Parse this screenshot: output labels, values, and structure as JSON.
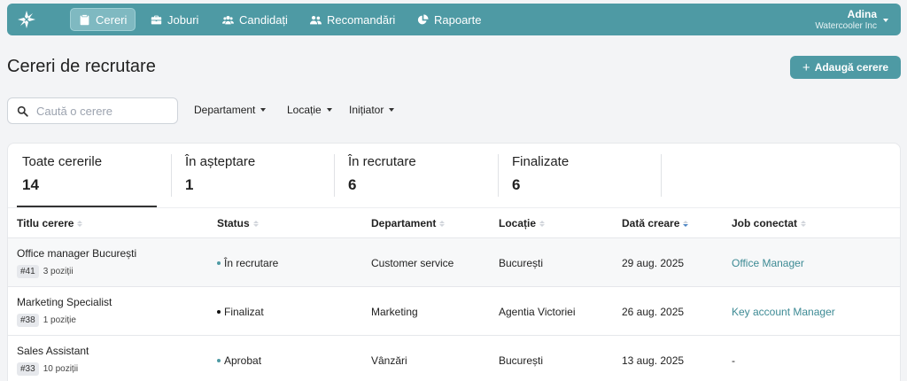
{
  "nav": {
    "items": [
      {
        "label": "Cereri",
        "icon": "clipboard-icon",
        "active": true
      },
      {
        "label": "Joburi",
        "icon": "briefcase-icon"
      },
      {
        "label": "Candidați",
        "icon": "users-icon"
      },
      {
        "label": "Recomandări",
        "icon": "user-pair-icon"
      },
      {
        "label": "Rapoarte",
        "icon": "pie-chart-icon"
      }
    ],
    "user": {
      "name": "Adina",
      "org": "Watercooler Inc"
    }
  },
  "page": {
    "title": "Cereri de recrutare",
    "add_label": "Adaugă cerere"
  },
  "search": {
    "placeholder": "Caută o cerere",
    "value": ""
  },
  "filters": [
    "Departament",
    "Locație",
    "Inițiator"
  ],
  "stats": [
    {
      "label": "Toate cererile",
      "count": "14"
    },
    {
      "label": "În așteptare",
      "count": "1"
    },
    {
      "label": "În recrutare",
      "count": "6"
    },
    {
      "label": "Finalizate",
      "count": "6"
    }
  ],
  "table": {
    "columns": [
      "Titlu cerere",
      "Status",
      "Departament",
      "Locație",
      "Dată creare",
      "Job conectat"
    ],
    "rows": [
      {
        "title": "Office manager București",
        "id": "#41",
        "positions": "3 poziții",
        "status": "În recrutare",
        "status_color": "#4e9aa4",
        "department": "Customer service",
        "location": "București",
        "date": "29 aug. 2025",
        "job": "Office Manager"
      },
      {
        "title": "Marketing Specialist",
        "id": "#38",
        "positions": "1 poziție",
        "status": "Finalizat",
        "status_color": "#111111",
        "department": "Marketing",
        "location": "Agentia Victoriei",
        "date": "26 aug. 2025",
        "job": "Key account Manager"
      },
      {
        "title": "Sales Assistant",
        "id": "#33",
        "positions": "10 poziții",
        "status": "Aprobat",
        "status_color": "#4e9aa4",
        "department": "Vânzări",
        "location": "București",
        "date": "13 aug. 2025",
        "job": "-"
      }
    ]
  },
  "colors": {
    "accent": "#4e9aa4",
    "link": "#3d8a94"
  }
}
